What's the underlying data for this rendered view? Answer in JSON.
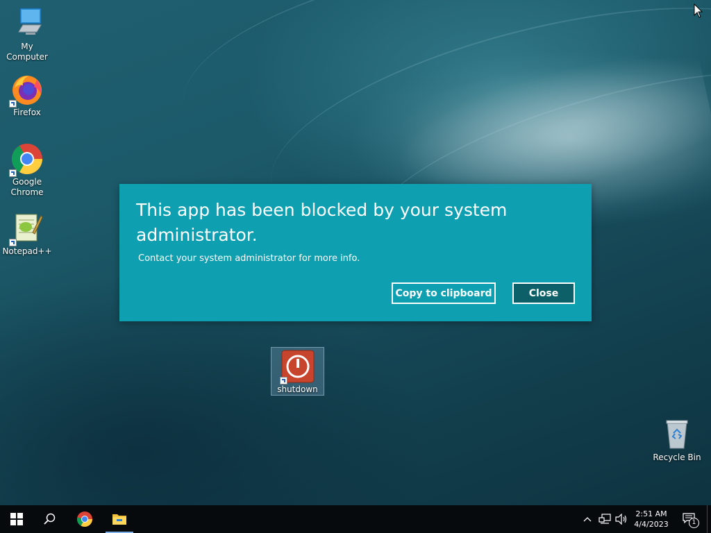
{
  "desktop": {
    "icons": [
      {
        "label": "My Computer"
      },
      {
        "label": "Firefox"
      },
      {
        "label": "Google Chrome"
      },
      {
        "label": "Notepad++"
      },
      {
        "label": "shutdown"
      },
      {
        "label": "Recycle Bin"
      }
    ]
  },
  "dialog": {
    "title": "This app has been blocked by your system administrator.",
    "body": "Contact your system administrator for more info.",
    "copy_label": "Copy to clipboard",
    "close_label": "Close",
    "accent": "#0e9fb0"
  },
  "taskbar": {
    "pinned": [
      "start-icon",
      "search-icon",
      "chrome-icon",
      "file-explorer-icon"
    ],
    "time": "2:51 AM",
    "date": "4/4/2023",
    "notification_count": "1"
  }
}
